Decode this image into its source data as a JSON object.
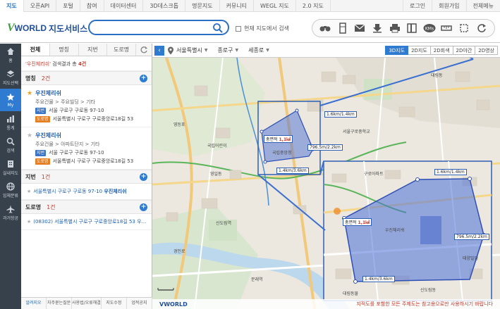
{
  "topnav": {
    "left": [
      "지도",
      "오픈API",
      "포털",
      "참여",
      "데이터센터",
      "3D데스크톱",
      "명문지도",
      "커뮤니티",
      "WEGL 지도",
      "2.0 지도"
    ],
    "right": [
      "로그인",
      "회원가입",
      "전체메뉴"
    ]
  },
  "logo": {
    "brand_v": "V",
    "brand_rest": "WORLD",
    "service": "지도서비스"
  },
  "search": {
    "placeholder": "",
    "value": ""
  },
  "current_map_search": "현재 지도에서 검색",
  "toolbar_icons": [
    "binoculars-icon",
    "parcel-icon",
    "mail-icon",
    "download-icon",
    "print-icon",
    "panel-icon",
    "km-icon",
    "ruler-icon",
    "area-icon",
    "refresh-icon"
  ],
  "toolbar_km": "KMs",
  "leftbar": [
    {
      "label": "홈",
      "icon": "home-icon"
    },
    {
      "label": "지도선택",
      "icon": "layers-icon"
    },
    {
      "label": "My",
      "icon": "star-icon"
    },
    {
      "label": "통계",
      "icon": "stats-icon"
    },
    {
      "label": "검색",
      "icon": "search-icon"
    },
    {
      "label": "실내지도",
      "icon": "building-icon"
    },
    {
      "label": "입체분류",
      "icon": "globe-icon"
    },
    {
      "label": "과거항공",
      "icon": "airplane-icon"
    }
  ],
  "panel": {
    "tabs": [
      "전체",
      "명칭",
      "지번",
      "도로명"
    ],
    "summary_kw": "'우진체리쉬'",
    "summary_text": " 검색결과 총 ",
    "summary_count": "4건",
    "name_section": {
      "label": "명칭",
      "count": "2건"
    },
    "results": [
      {
        "title": "우진체리쉬",
        "category": "주요건물 > 주요빌딩 > 기타",
        "jibun_badge": "지번",
        "jibun": "서울 구로구 구로동 97-10",
        "road_badge": "도로명",
        "road": "서울특별시 구로구 구로중앙로18길 53"
      },
      {
        "title": "우진체리쉬",
        "category": "주요건물 > 아파트단지 > 기타",
        "jibun_badge": "지번",
        "jibun": "서울 구로구 구로동 97-10",
        "road_badge": "도로명",
        "road": "서울특별시 구로구 구로중앙로18길 53"
      }
    ],
    "jibun_section": {
      "label": "지번",
      "count": "1건"
    },
    "jibun_item": {
      "prefix": "서울특별시 구로구 구로동 97-10 ",
      "highlight": "우진체리쉬"
    },
    "road_section": {
      "label": "도로명",
      "count": "1건"
    },
    "road_item": {
      "text": "(08302) 서울특별시 구로구 구로중앙로18길 53 우..."
    },
    "footer": [
      "알려지오",
      "자주묻는질문",
      "사용법/오류해결",
      "지도수정",
      "업적공지"
    ]
  },
  "mapbar": {
    "dropdowns": [
      "서울특별시",
      "종로구",
      "세종로"
    ],
    "modes": [
      "3D지도",
      "2D지도",
      "2D회색",
      "2D야간",
      "2D영상"
    ],
    "active_mode": "3D지도"
  },
  "map": {
    "area_small": {
      "label": "총면적",
      "value": "1,1㎢",
      "edge1": "1.6km/1.4km",
      "edge2": "796.5m/2.2km",
      "edge3": "1.4km/3.6km"
    },
    "area_large": {
      "label": "총면적",
      "value": "1,1㎢",
      "edge1": "1.6km/1.4km",
      "edge2": "796.5m/2.2km",
      "edge3": "1.4km/3.6km"
    },
    "places": [
      "국립어린이",
      "영등포",
      "신도림역",
      "국립중앙청",
      "우진체리쉬",
      "영일동",
      "서울구로중학교",
      "대림동",
      "구로아파트",
      "태양빌딩",
      "대림동물",
      "신도림동",
      "경인로",
      "문래역"
    ],
    "bottom_brand": "VWORLD",
    "bottom_note": "지적도를 포함한 모든 주제도는 참고용으로만 사용하시기 바랍니다"
  },
  "colors": {
    "accent": "#2e7bd1",
    "polygon": "#4a6fd8",
    "warn": "#c0392b"
  }
}
